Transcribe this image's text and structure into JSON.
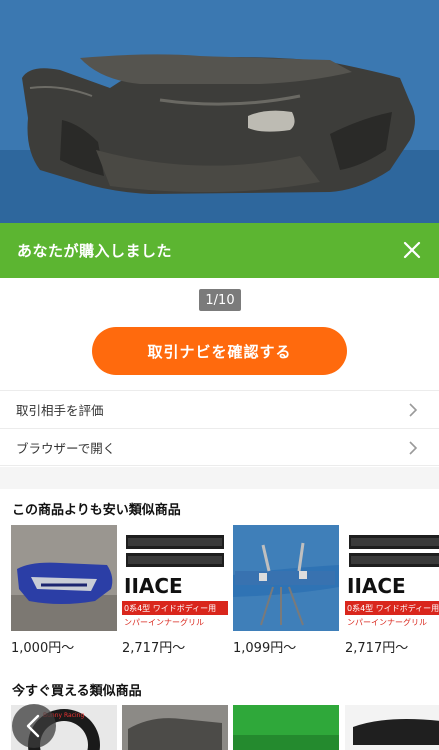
{
  "banner": {
    "title": "あなたが購入しました",
    "close_icon": "close-icon"
  },
  "gallery": {
    "counter": "1/10"
  },
  "actions": {
    "navi_button": "取引ナビを確認する"
  },
  "menu": {
    "evaluate_label": "取引相手を評価",
    "browser_label": "ブラウザーで開く"
  },
  "similar_cheaper": {
    "title": "この商品よりも安い類似商品",
    "items": [
      {
        "price": "1,000円〜"
      },
      {
        "price": "2,717円〜",
        "thumb_text": "IIACE",
        "thumb_sub": "0系4型 ワイドボディー用",
        "thumb_sub2": "ンパーインナーグリル"
      },
      {
        "price": "1,099円〜"
      },
      {
        "price": "2,717円〜",
        "thumb_text": "IIACE",
        "thumb_sub": "0系4型 ワイドボディー用",
        "thumb_sub2": "ンパーインナーグリル"
      }
    ]
  },
  "similar_now": {
    "title": "今すぐ買える類似商品",
    "item_text": "Bunny Racing"
  },
  "colors": {
    "accent_green": "#5cb531",
    "accent_orange": "#ff6a0d"
  }
}
